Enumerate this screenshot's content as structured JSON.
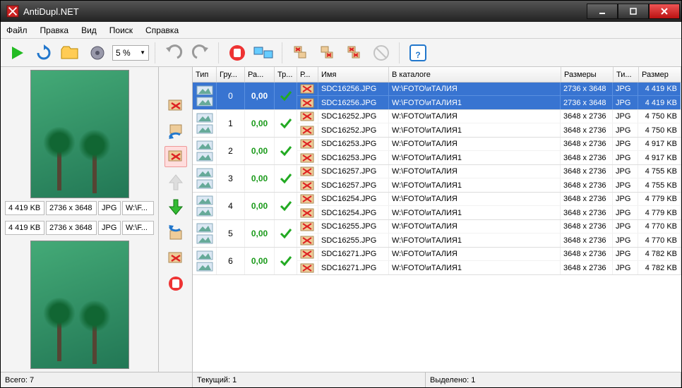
{
  "window": {
    "title": "AntiDupl.NET"
  },
  "menu": {
    "file": "Файл",
    "edit": "Правка",
    "view": "Вид",
    "search": "Поиск",
    "help": "Справка"
  },
  "toolbar": {
    "percent": "5 %"
  },
  "preview": {
    "top": {
      "size": "4 419 KB",
      "dims": "2736 x 3648",
      "type": "JPG",
      "path": "W:\\F..."
    },
    "bottom": {
      "size": "4 419 KB",
      "dims": "2736 x 3648",
      "type": "JPG",
      "path": "W:\\F..."
    }
  },
  "grid": {
    "headers": {
      "type": "Тип",
      "group": "Гру...",
      "diff": "Ра...",
      "tr": "Тр...",
      "r": "Р...",
      "name": "Имя",
      "folder": "В каталоге",
      "dims": "Размеры",
      "ftype": "Ти...",
      "fsize": "Размер"
    },
    "rows": [
      {
        "selected": true,
        "group": 0,
        "diff": "0,00",
        "items": [
          {
            "name": "SDC16256.JPG",
            "folder": "W:\\FOTO\\иТАЛИЯ",
            "dims": "2736 x 3648",
            "type": "JPG",
            "size": "4 419 KB"
          },
          {
            "name": "SDC16256.JPG",
            "folder": "W:\\FOTO\\иТАЛИЯ1",
            "dims": "2736 x 3648",
            "type": "JPG",
            "size": "4 419 KB"
          }
        ]
      },
      {
        "group": 1,
        "diff": "0,00",
        "items": [
          {
            "name": "SDC16252.JPG",
            "folder": "W:\\FOTO\\иТАЛИЯ",
            "dims": "3648 x 2736",
            "type": "JPG",
            "size": "4 750 KB"
          },
          {
            "name": "SDC16252.JPG",
            "folder": "W:\\FOTO\\иТАЛИЯ1",
            "dims": "3648 x 2736",
            "type": "JPG",
            "size": "4 750 KB"
          }
        ]
      },
      {
        "group": 2,
        "diff": "0,00",
        "items": [
          {
            "name": "SDC16253.JPG",
            "folder": "W:\\FOTO\\иТАЛИЯ",
            "dims": "3648 x 2736",
            "type": "JPG",
            "size": "4 917 KB"
          },
          {
            "name": "SDC16253.JPG",
            "folder": "W:\\FOTO\\иТАЛИЯ1",
            "dims": "3648 x 2736",
            "type": "JPG",
            "size": "4 917 KB"
          }
        ]
      },
      {
        "group": 3,
        "diff": "0,00",
        "items": [
          {
            "name": "SDC16257.JPG",
            "folder": "W:\\FOTO\\иТАЛИЯ",
            "dims": "3648 x 2736",
            "type": "JPG",
            "size": "4 755 KB"
          },
          {
            "name": "SDC16257.JPG",
            "folder": "W:\\FOTO\\иТАЛИЯ1",
            "dims": "3648 x 2736",
            "type": "JPG",
            "size": "4 755 KB"
          }
        ]
      },
      {
        "group": 4,
        "diff": "0,00",
        "items": [
          {
            "name": "SDC16254.JPG",
            "folder": "W:\\FOTO\\иТАЛИЯ",
            "dims": "3648 x 2736",
            "type": "JPG",
            "size": "4 779 KB"
          },
          {
            "name": "SDC16254.JPG",
            "folder": "W:\\FOTO\\иТАЛИЯ1",
            "dims": "3648 x 2736",
            "type": "JPG",
            "size": "4 779 KB"
          }
        ]
      },
      {
        "group": 5,
        "diff": "0,00",
        "items": [
          {
            "name": "SDC16255.JPG",
            "folder": "W:\\FOTO\\иТАЛИЯ",
            "dims": "3648 x 2736",
            "type": "JPG",
            "size": "4 770 KB"
          },
          {
            "name": "SDC16255.JPG",
            "folder": "W:\\FOTO\\иТАЛИЯ1",
            "dims": "3648 x 2736",
            "type": "JPG",
            "size": "4 770 KB"
          }
        ]
      },
      {
        "group": 6,
        "diff": "0,00",
        "items": [
          {
            "name": "SDC16271.JPG",
            "folder": "W:\\FOTO\\иТАЛИЯ",
            "dims": "3648 x 2736",
            "type": "JPG",
            "size": "4 782 KB"
          },
          {
            "name": "SDC16271.JPG",
            "folder": "W:\\FOTO\\иТАЛИЯ1",
            "dims": "3648 x 2736",
            "type": "JPG",
            "size": "4 782 KB"
          }
        ]
      }
    ]
  },
  "status": {
    "total": "Всего: 7",
    "current": "Текущий: 1",
    "selected": "Выделено: 1"
  }
}
